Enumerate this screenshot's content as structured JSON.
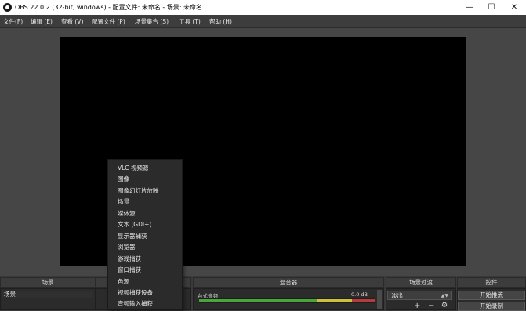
{
  "window": {
    "title": "OBS 22.0.2 (32-bit, windows) - 配置文件: 未命名 - 场景: 未命名",
    "minimize": "—",
    "maximize": "☐",
    "close": "✕"
  },
  "menu": [
    "文件(F)",
    "编辑 (E)",
    "查看 (V)",
    "配置文件 (P)",
    "场景集合 (S)",
    "工具 (T)",
    "帮助 (H)"
  ],
  "panels": {
    "scenes_header": "场景",
    "scene_item": "场景",
    "mixer_header": "混音器",
    "transitions_header": "场景过渡",
    "controls_header": "控件"
  },
  "mixer": {
    "track_name": "台式音频",
    "level": "0.0 dB"
  },
  "transitions": {
    "selected": "淡出",
    "add": "+",
    "remove": "−",
    "settings": "⚙"
  },
  "controls": {
    "start_streaming": "开始推流",
    "start_recording": "开始录制"
  },
  "context_menu": [
    "VLC 视频源",
    "图像",
    "图像幻灯片放映",
    "场景",
    "媒体源",
    "文本 (GDI+)",
    "显示器捕获",
    "浏览器",
    "游戏捕获",
    "窗口捕获",
    "色源",
    "视频捕获设备",
    "音频输入捕获"
  ],
  "colors": {
    "background": "#3a3a3a",
    "preview_canvas": "#000000",
    "meter_green": "#4aa63a",
    "meter_yellow": "#c9c23a",
    "meter_red": "#b83a3a"
  }
}
